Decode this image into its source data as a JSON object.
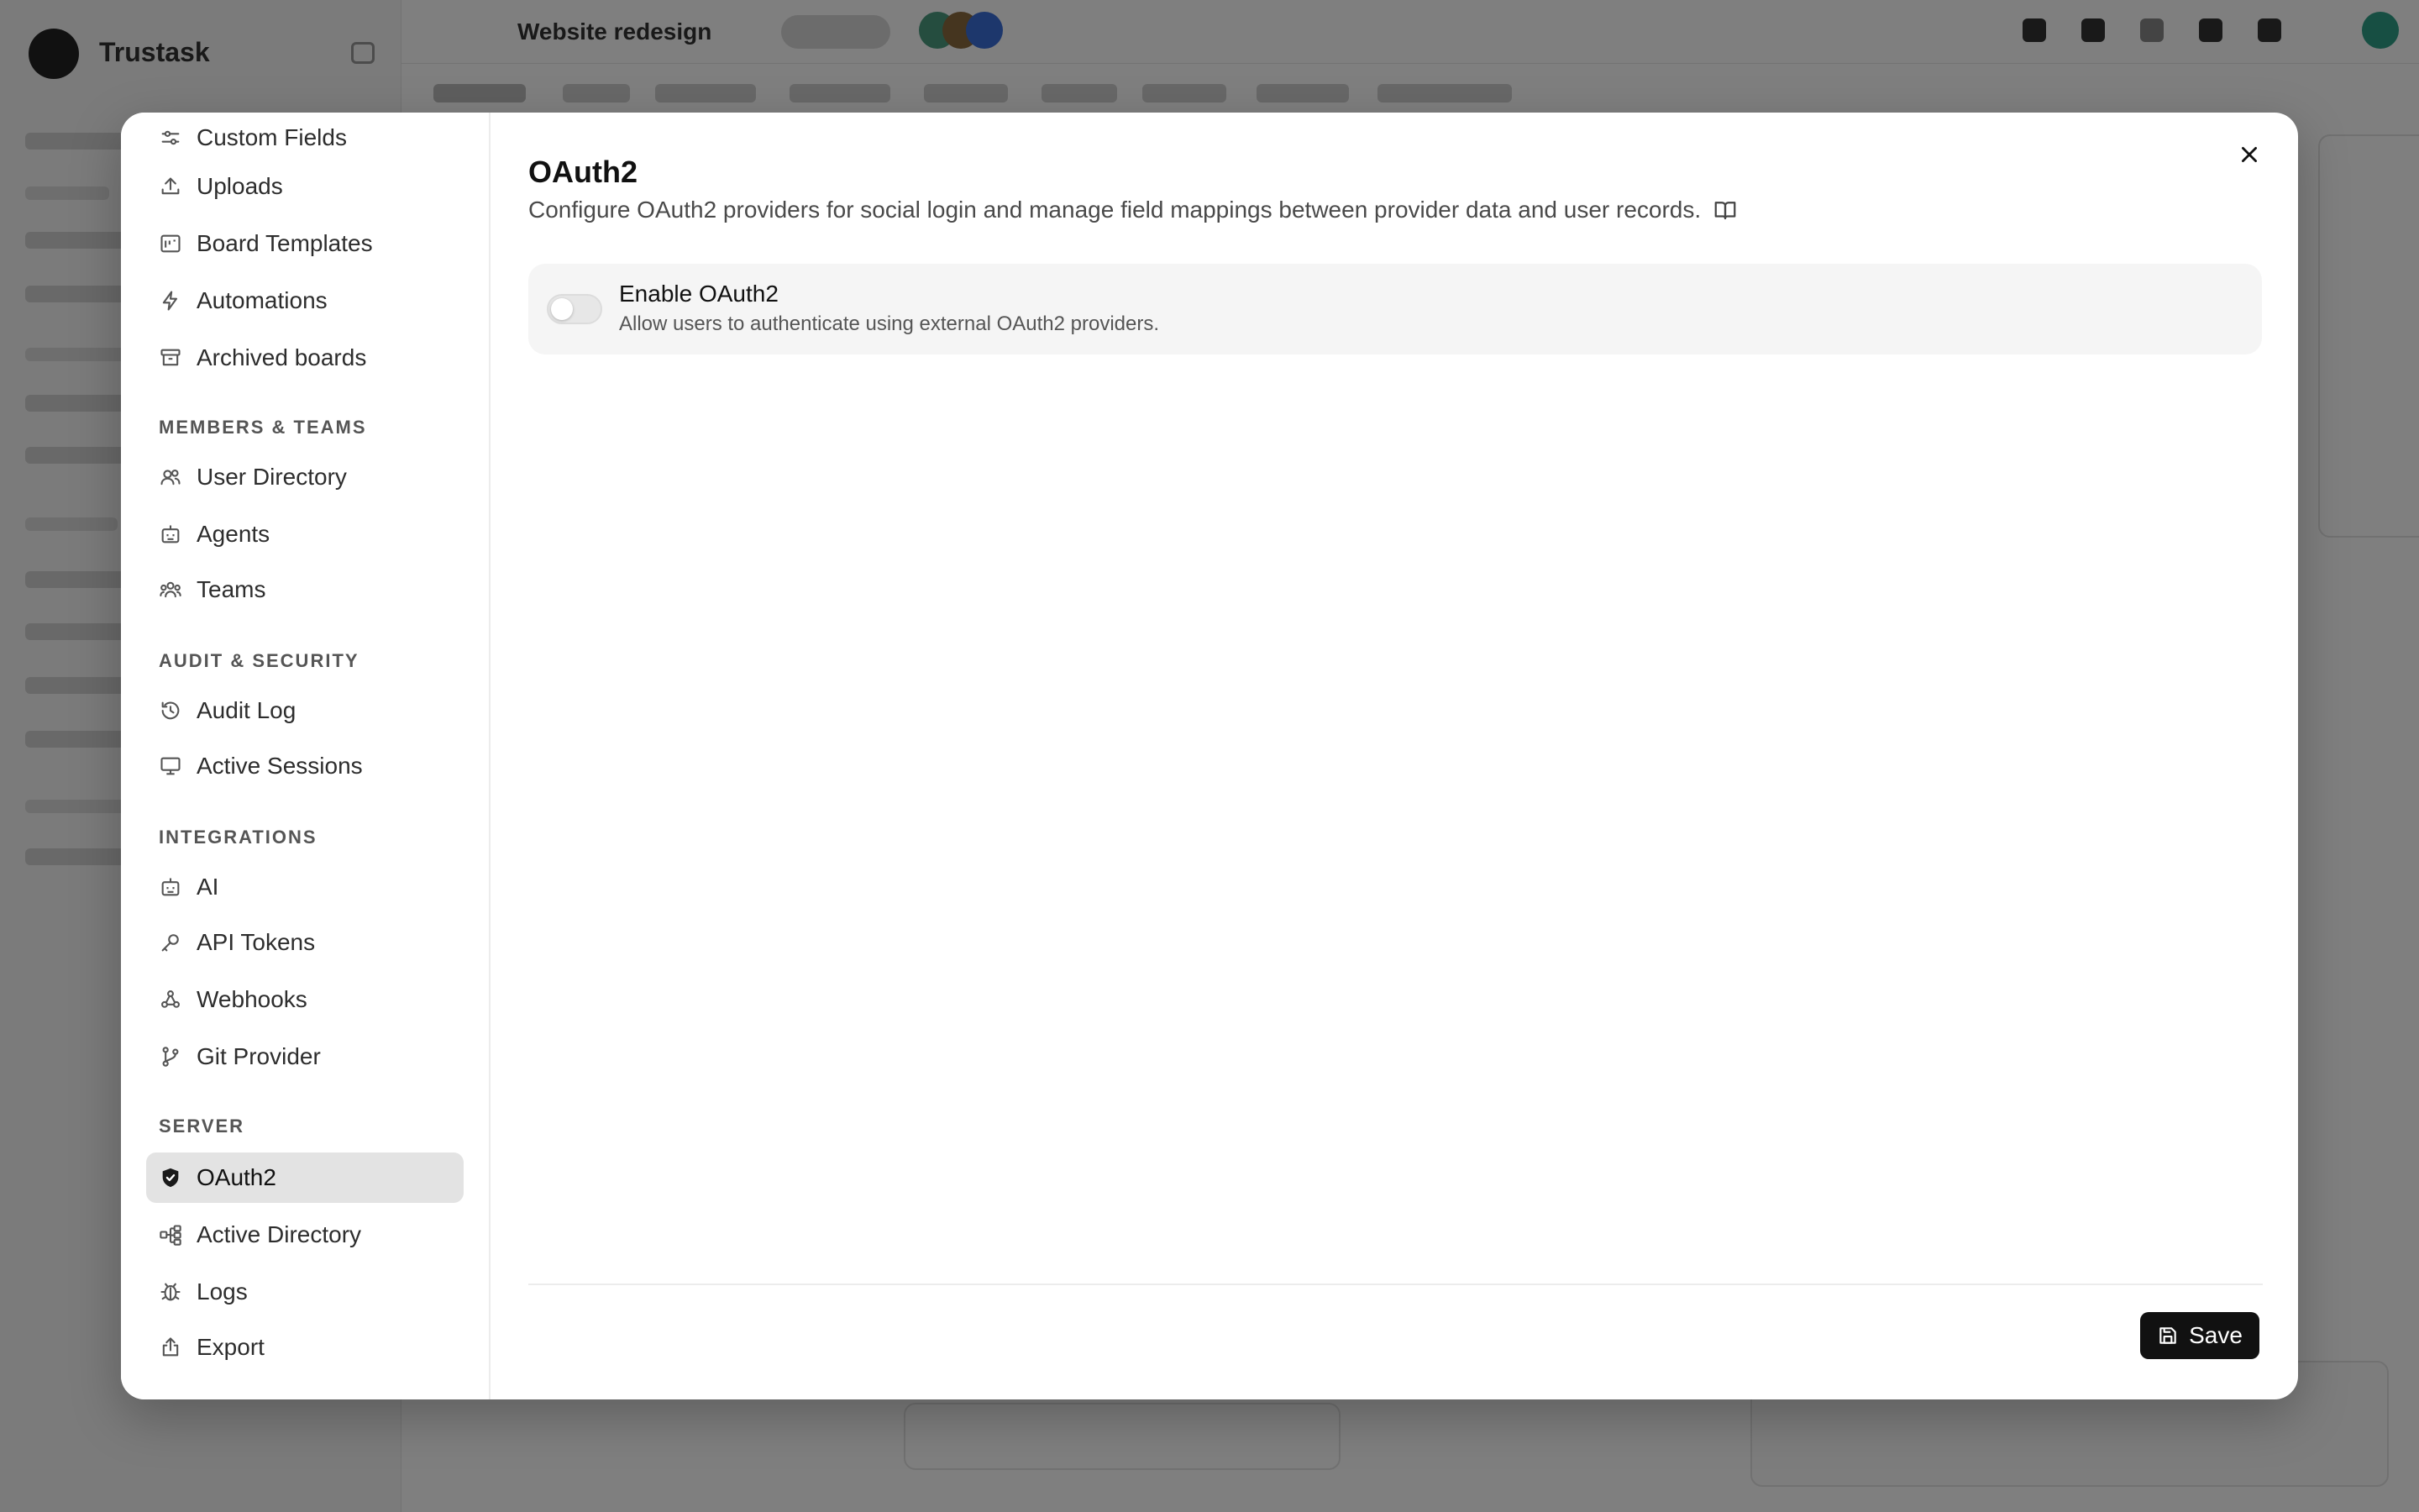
{
  "background": {
    "brand": "Trustask",
    "project_title": "Website redesign"
  },
  "settings_nav": {
    "items_top": [
      {
        "label": "Custom Fields",
        "icon": "sliders-icon"
      },
      {
        "label": "Uploads",
        "icon": "upload-icon"
      },
      {
        "label": "Board Templates",
        "icon": "template-icon"
      },
      {
        "label": "Automations",
        "icon": "lightning-icon"
      },
      {
        "label": "Archived boards",
        "icon": "archive-icon"
      }
    ],
    "members_teams": {
      "label": "MEMBERS & TEAMS",
      "items": [
        {
          "label": "User Directory",
          "icon": "users-icon"
        },
        {
          "label": "Agents",
          "icon": "bot-icon"
        },
        {
          "label": "Teams",
          "icon": "team-icon"
        }
      ]
    },
    "audit_security": {
      "label": "AUDIT & SECURITY",
      "items": [
        {
          "label": "Audit Log",
          "icon": "history-icon"
        },
        {
          "label": "Active Sessions",
          "icon": "monitor-icon"
        }
      ]
    },
    "integrations": {
      "label": "INTEGRATIONS",
      "items": [
        {
          "label": "AI",
          "icon": "bot-icon"
        },
        {
          "label": "API Tokens",
          "icon": "key-icon"
        },
        {
          "label": "Webhooks",
          "icon": "webhook-icon"
        },
        {
          "label": "Git Provider",
          "icon": "git-branch-icon"
        }
      ]
    },
    "server": {
      "label": "SERVER",
      "items": [
        {
          "label": "OAuth2",
          "icon": "shield-check-icon",
          "active": true
        },
        {
          "label": "Active Directory",
          "icon": "network-icon"
        },
        {
          "label": "Logs",
          "icon": "bug-icon"
        },
        {
          "label": "Export",
          "icon": "export-icon"
        }
      ]
    }
  },
  "panel": {
    "title": "OAuth2",
    "description": "Configure OAuth2 providers for social login and manage field mappings between provider data and user records.",
    "enable": {
      "title": "Enable OAuth2",
      "subtitle": "Allow users to authenticate using external OAuth2 providers.",
      "enabled": false
    },
    "save_label": "Save"
  },
  "colors": {
    "accent": "#111111",
    "active_nav_bg": "#e3e3e3",
    "card_bg": "#f5f5f5"
  }
}
